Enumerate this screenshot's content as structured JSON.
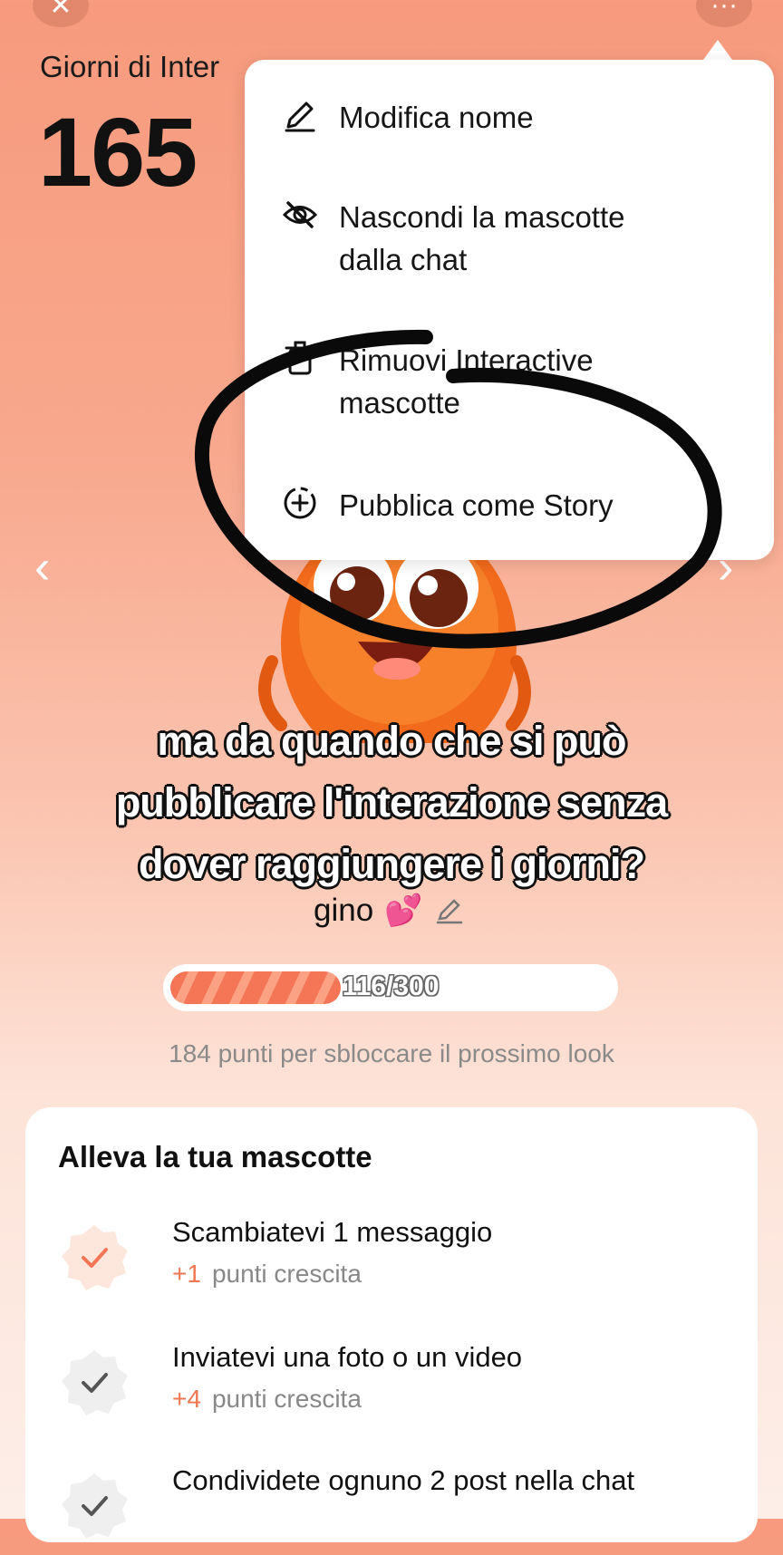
{
  "header": {
    "close_label": "✕",
    "more_label": "···",
    "days_label": "Giorni di Inter",
    "days_value": "165"
  },
  "menu": {
    "items": [
      {
        "icon": "pencil-icon",
        "label_line1": "Modifica nome",
        "label_line2": ""
      },
      {
        "icon": "eye-off-icon",
        "label_line1": "Nascondi la mascotte",
        "label_line2": "dalla chat"
      },
      {
        "icon": "trash-icon",
        "label_line1": "Rimuovi Interactive",
        "label_line2": "mascotte"
      },
      {
        "icon": "add-story-icon",
        "label_line1": "Pubblica come Story",
        "label_line2": ""
      }
    ]
  },
  "overlay_caption": {
    "line1": "ma da quando che si può",
    "line2": "pubblicare l'interazione senza",
    "line3": "dover raggiungere i giorni?"
  },
  "pet": {
    "name": "gino",
    "emoji": "💕"
  },
  "progress": {
    "current": 116,
    "max": 300,
    "text": "116/300",
    "hint": "184 punti per sbloccare il prossimo look"
  },
  "tasks_card": {
    "title": "Alleva la tua mascotte",
    "tasks": [
      {
        "title": "Scambiatevi 1 messaggio",
        "points": "+1",
        "points_label": "punti crescita",
        "done": true
      },
      {
        "title": "Inviatevi una foto o un video",
        "points": "+4",
        "points_label": "punti crescita",
        "done": false
      },
      {
        "title": "Condividete ognuno 2 post nella chat",
        "points": "",
        "points_label": "",
        "done": false
      }
    ]
  },
  "colors": {
    "accent": "#f47656",
    "background_top": "#f79a7d",
    "background_bottom": "#fdeee8"
  }
}
